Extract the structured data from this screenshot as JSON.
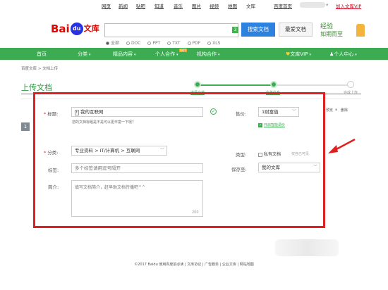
{
  "topbar": {
    "links": [
      "网页",
      "新闻",
      "贴吧",
      "知道",
      "音乐",
      "图片",
      "视频",
      "地图",
      "文库"
    ],
    "home": "百度首页",
    "vip": "加入文库VIP",
    "vip_caret": "▾"
  },
  "header": {
    "logo": {
      "bai": "Bai",
      "paw": "du",
      "wenku": "文库"
    },
    "search": {
      "placeholder": "",
      "badge": "3"
    },
    "search_button": "搜索文档",
    "save_button": "最爱文档",
    "filters": [
      "全部",
      "DOC",
      "PPT",
      "TXT",
      "PDF",
      "XLS"
    ],
    "selected_filter": "全部",
    "promo": {
      "line1": "经验",
      "line2": "如期而至"
    }
  },
  "nav": {
    "items": [
      {
        "label": "首页",
        "caret": ""
      },
      {
        "label": "分类",
        "caret": "▾"
      },
      {
        "label": "精品内容",
        "caret": "▾"
      },
      {
        "label": "个人合作",
        "caret": "▾"
      },
      {
        "label": "机构合作",
        "caret": "▾"
      }
    ],
    "hot_badge": "HOT",
    "vip": {
      "label": "文库VIP",
      "caret": "▾"
    },
    "user": {
      "label": "个人中心",
      "caret": "▾"
    }
  },
  "breadcrumb": "百度文库 > 文档上传",
  "page_title": "上传文档",
  "steps": [
    {
      "label": "选择文档",
      "state": "done"
    },
    {
      "label": "完善信息",
      "state": "current"
    },
    {
      "label": "完成上传",
      "state": "todo"
    }
  ],
  "form": {
    "index": "1",
    "title": {
      "label": "标题:",
      "value": "我的互联网",
      "hint": "您的文档标题是不是可以更丰富一下呢?"
    },
    "price": {
      "label": "售价:",
      "value": "1财富值",
      "arrow": "﹀"
    },
    "smart_price": {
      "label": "开启智能调价",
      "checked": true,
      "check": "✓"
    },
    "actions": {
      "preview": "预览",
      "delete": "删除",
      "sep": "▪"
    },
    "category": {
      "label": "分类:",
      "value": "专业资料 > IT/计算机 > 互联网",
      "arrow": "﹀"
    },
    "type": {
      "label": "类型:",
      "option": "私有文档",
      "hint": "仅自己可见",
      "checked": false
    },
    "tags": {
      "label": "标签:",
      "placeholder": "多个标签请用逗号隔开"
    },
    "save_to": {
      "label": "保存至:",
      "value": "我的文库",
      "arrow": "﹀"
    },
    "intro": {
      "label": "简介:",
      "placeholder": "填写文档简介，赶早助文档传播吧^^",
      "counter": "200"
    }
  },
  "footer": "©2017 Baidu 使用百度前必读 | 文库协议 | 广告服务 | 企业文库 | 网站地图"
}
